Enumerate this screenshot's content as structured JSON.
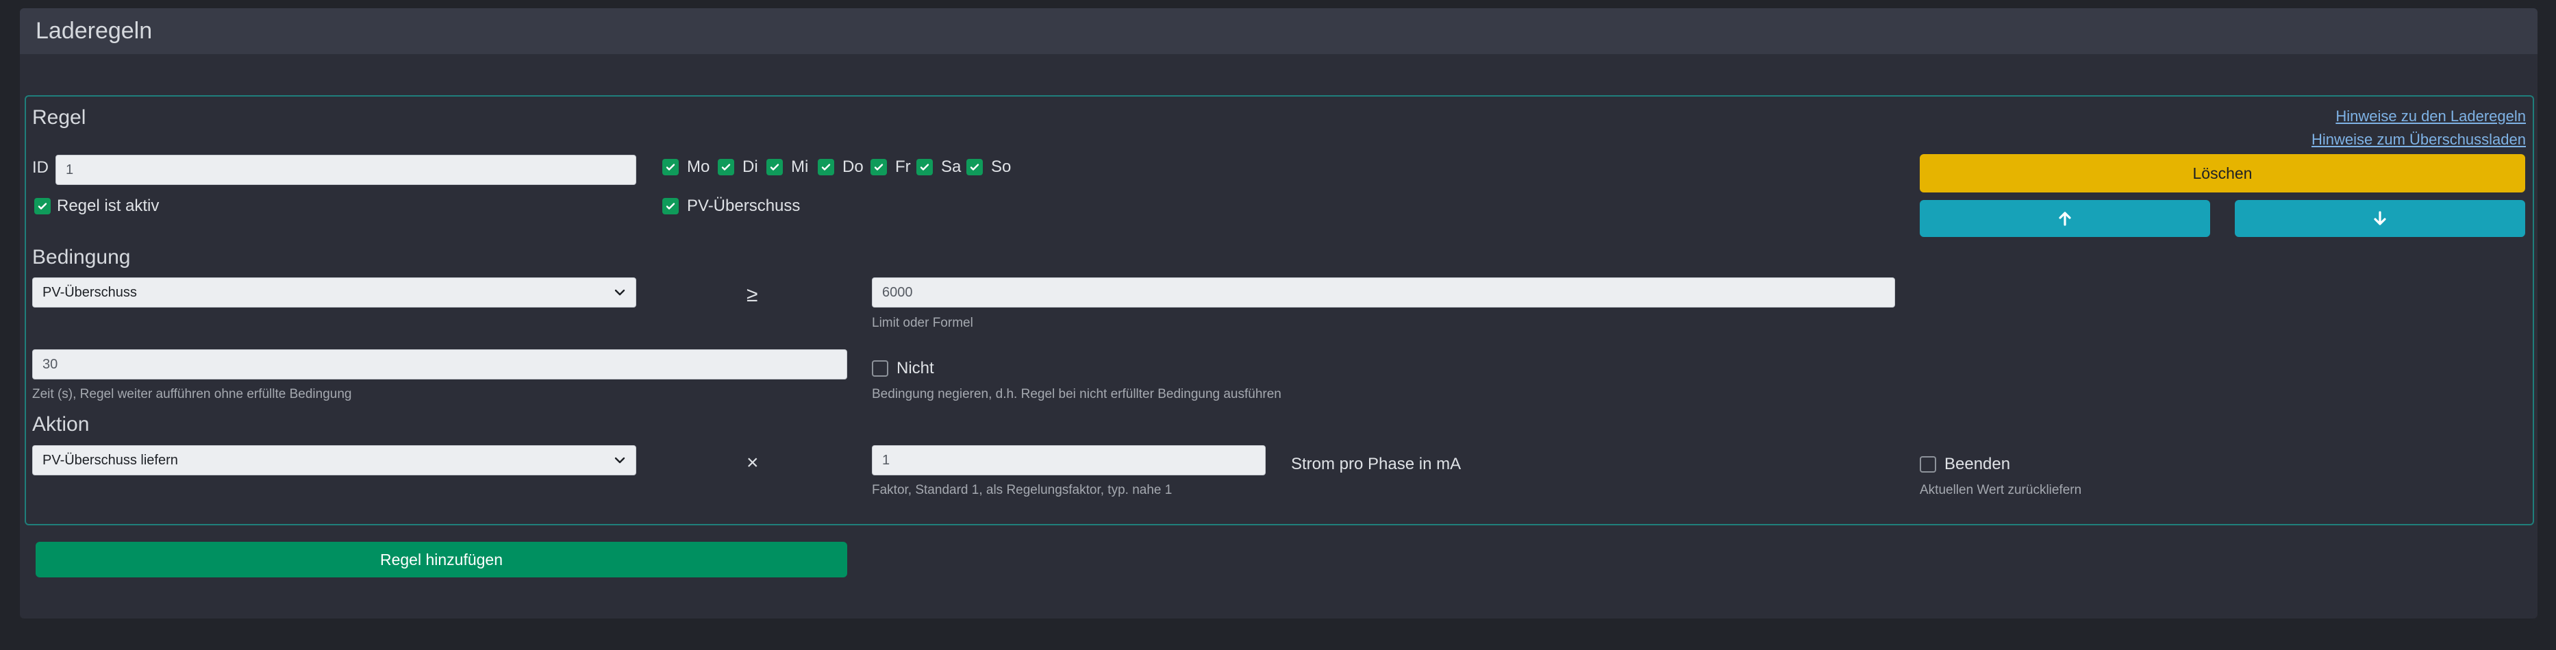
{
  "page": {
    "title": "Laderegeln"
  },
  "rule": {
    "section_title": "Regel",
    "id_label": "ID",
    "id_value": "1",
    "active_label": "Regel ist aktiv",
    "days": [
      {
        "label": "Mo",
        "checked": true
      },
      {
        "label": "Di",
        "checked": true
      },
      {
        "label": "Mi",
        "checked": true
      },
      {
        "label": "Do",
        "checked": true
      },
      {
        "label": "Fr",
        "checked": true
      },
      {
        "label": "Sa",
        "checked": true
      },
      {
        "label": "So",
        "checked": true
      }
    ],
    "pv_label": "PV-Überschuss",
    "links": {
      "rules_hint": "Hinweise zu den Laderegeln",
      "surplus_hint": "Hinweise zum Überschussladen"
    },
    "delete_label": "Löschen",
    "condition": {
      "section_title": "Bedingung",
      "select_value": "PV-Überschuss",
      "operator": "≥",
      "limit_value": "6000",
      "limit_help": "Limit oder Formel",
      "time_value": "30",
      "time_help": "Zeit (s), Regel weiter aufführen ohne erfüllte Bedingung",
      "negate_label": "Nicht",
      "negate_help": "Bedingung negieren, d.h. Regel bei nicht erfüllter Bedingung ausführen"
    },
    "action": {
      "section_title": "Aktion",
      "select_value": "PV-Überschuss liefern",
      "operator": "×",
      "factor_value": "1",
      "factor_help": "Faktor, Standard 1, als Regelungsfaktor, typ. nahe 1",
      "unit_label": "Strom pro Phase in mA",
      "end_label": "Beenden",
      "end_help": "Aktuellen Wert zurückliefern"
    }
  },
  "add_rule_label": "Regel hinzufügen",
  "colors": {
    "background": "#22242a",
    "card": "#2c2e38",
    "header": "#383b47",
    "border_accent": "#1f7f7b",
    "checkbox": "#0f9b5a",
    "delete": "#e6b400",
    "move": "#17a2b8",
    "add": "#009060",
    "link": "#7fb3e6"
  }
}
